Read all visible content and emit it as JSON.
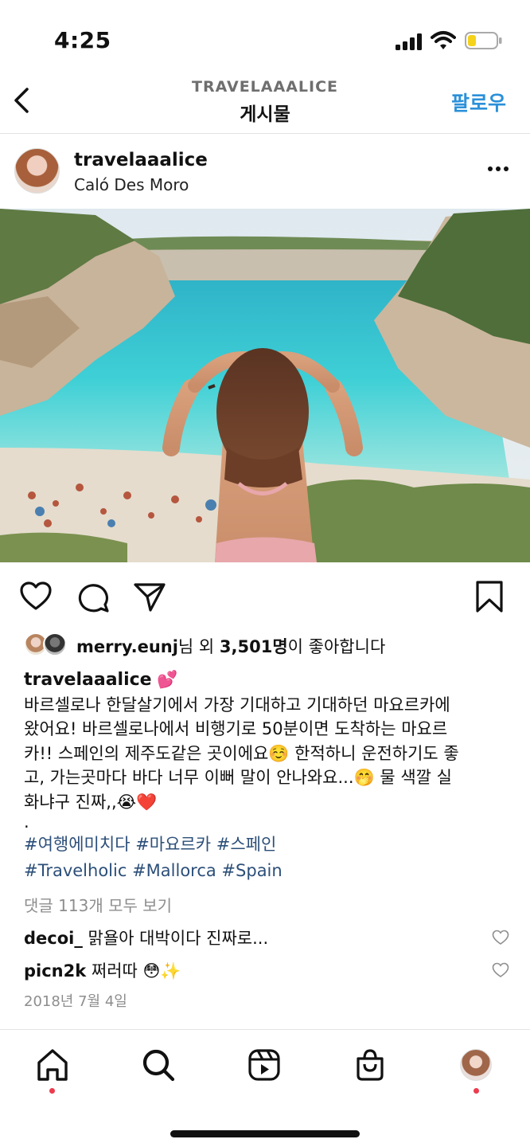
{
  "status": {
    "time": "4:25"
  },
  "header": {
    "subtitle": "TRAVELAAALICE",
    "title": "게시물",
    "follow_label": "팔로우"
  },
  "post": {
    "username": "travelaaalice",
    "location": "Caló Des Moro",
    "likes": {
      "user": "merry.eunj",
      "mid": "님 외 ",
      "count": "3,501명",
      "suffix": "이 좋아합니다"
    },
    "caption": {
      "username": "travelaaalice",
      "username_emoji": "💕",
      "lines": [
        "바르셀로나 한달살기에서 가장 기대하고 기대하던 마요르카에",
        "왔어요! 바르셀로나에서 비행기로 50분이면 도착하는 마요르",
        "카!! 스페인의 제주도같은 곳이에요☺️ 한적하니 운전하기도 좋",
        "고, 가는곳마다 바다 너무 이뻐 말이 안나와요...🤭 물 색깔 실",
        "화냐구 진짜,,😭❤️"
      ],
      "dot": ".",
      "hashtags_line1": "#여행에미치다 #마요르카 #스페인",
      "hashtags_line2": "#Travelholic #Mallorca #Spain"
    },
    "view_all_comments": "댓글 113개 모두 보기",
    "comments": [
      {
        "user": "decoi_",
        "text": "맑욜아 대박이다 진짜로..."
      },
      {
        "user": "picn2k",
        "text": "쩌러따 😳✨"
      }
    ],
    "date": "2018년 7월 4일"
  },
  "icons": {
    "back": "chevron-left-icon",
    "more": "more-dots-icon",
    "like": "heart-icon",
    "comment": "comment-icon",
    "share": "send-icon",
    "save": "bookmark-icon",
    "nav": [
      "home-icon",
      "search-icon",
      "reels-icon",
      "shop-icon",
      "profile-avatar"
    ]
  },
  "colors": {
    "link": "#2b90d9",
    "hashtag": "#2c4f79",
    "notification_dot": "#ed3b4e",
    "battery": "#f5d21c"
  }
}
